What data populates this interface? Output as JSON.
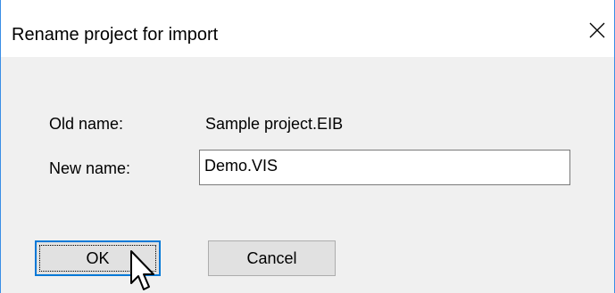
{
  "dialog": {
    "title": "Rename project for import",
    "close_icon": "close-icon"
  },
  "form": {
    "old_name_label": "Old name:",
    "old_name_value": "Sample project.EIB",
    "new_name_label": "New name:",
    "new_name_value": "Demo.VIS"
  },
  "buttons": {
    "ok_label": "OK",
    "cancel_label": "Cancel"
  },
  "colors": {
    "accent": "#0078d7",
    "window_border": "#3a8ee6",
    "dialog_bg": "#f0f0f0",
    "button_bg": "#e1e1e1"
  },
  "icons": {
    "cursor": "mouse-pointer-icon"
  }
}
